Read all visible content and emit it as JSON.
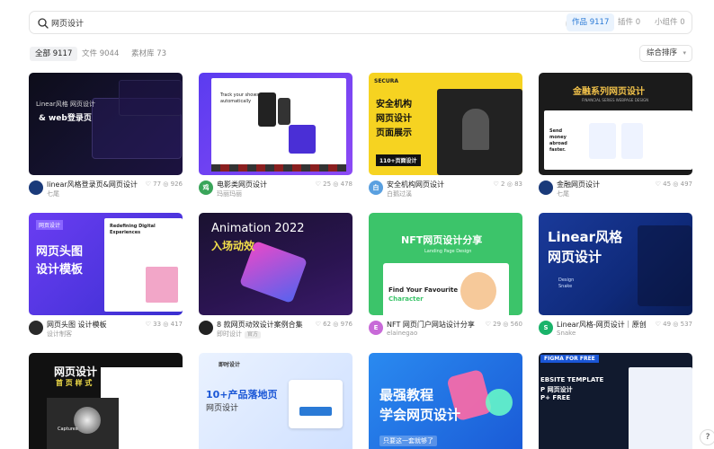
{
  "search": {
    "value": "网页设计",
    "clear_icon": "×"
  },
  "scopes": [
    {
      "label": "作品",
      "count": "9117",
      "active": true
    },
    {
      "label": "插件",
      "count": "0"
    },
    {
      "label": "小组件",
      "count": "0"
    }
  ],
  "filters": [
    {
      "label": "全部",
      "count": "9117",
      "active": true
    },
    {
      "label": "文件",
      "count": "9044"
    },
    {
      "label": "素材库",
      "count": "73"
    }
  ],
  "sort": {
    "label": "综合排序",
    "chevron": "▾"
  },
  "cards": [
    {
      "title": "linear风格登录页&网页设计",
      "author": "七尾",
      "likes": "77",
      "views": "926",
      "thumb": {
        "lines": [
          "Linear风格 网页设计",
          "& web登录页"
        ]
      }
    },
    {
      "title": "电影类网页设计",
      "author": "玛丽玛丽",
      "likes": "25",
      "views": "478",
      "thumb": {
        "lines": [
          "Track your shows",
          "automatically"
        ]
      }
    },
    {
      "title": "安全机构网页设计",
      "author": "白鹅过溪",
      "likes": "2",
      "views": "83",
      "thumb": {
        "lines": [
          "SECURA",
          "安全机构",
          "网页设计",
          "页面展示",
          "110+页面设计"
        ]
      }
    },
    {
      "title": "金融网页设计",
      "author": "七尾",
      "likes": "45",
      "views": "497",
      "thumb": {
        "lines": [
          "金融系列网页设计",
          "FINANCIAL SERIES WEBPAGE DESIGN",
          "Send money abroad faster."
        ]
      }
    },
    {
      "title": "网页头图 设计模板",
      "author": "设计制客",
      "likes": "33",
      "views": "417",
      "thumb": {
        "lines": [
          "网页设计",
          "网页头图",
          "设计模板",
          "Redefining Digital Experiences"
        ]
      }
    },
    {
      "title": "8 款网页动效设计案例合集",
      "author": "即时设计",
      "badge": "官方",
      "likes": "62",
      "views": "976",
      "thumb": {
        "lines": [
          "Animation 2022",
          "入场动效"
        ]
      }
    },
    {
      "title": "NFT 网页门户网站设计分享",
      "author": "elainegao",
      "likes": "29",
      "views": "560",
      "thumb": {
        "lines": [
          "NFT网页设计分享",
          "Landing Page Design",
          "Find Your Favourite",
          "Character"
        ]
      }
    },
    {
      "title": "Linear风格-网页设计｜原创",
      "author": "Snake",
      "likes": "49",
      "views": "537",
      "thumb": {
        "lines": [
          "Linear风格",
          "网页设计",
          "Design Snake"
        ]
      }
    },
    {
      "title": "",
      "author": "",
      "likes": "",
      "views": "",
      "thumb": {
        "lines": [
          "网页设计",
          "首 页 样 式",
          "Captures"
        ]
      }
    },
    {
      "title": "",
      "author": "",
      "likes": "",
      "views": "",
      "thumb": {
        "lines": [
          "即时设计",
          "10+产品落地页",
          "网页设计"
        ]
      }
    },
    {
      "title": "",
      "author": "",
      "likes": "",
      "views": "",
      "thumb": {
        "lines": [
          "最强教程",
          "学会网页设计",
          "只要这一套就够了"
        ]
      }
    },
    {
      "title": "",
      "author": "",
      "likes": "",
      "views": "",
      "thumb": {
        "lines": [
          "FIGMA FOR FREE",
          "EBSITE TEMPLATE",
          "P 网页设计",
          "P+ FREE"
        ]
      }
    }
  ],
  "help": "?",
  "colors": {
    "accent": "#2a7ad6",
    "scope_bg": "#eaf3fd"
  }
}
